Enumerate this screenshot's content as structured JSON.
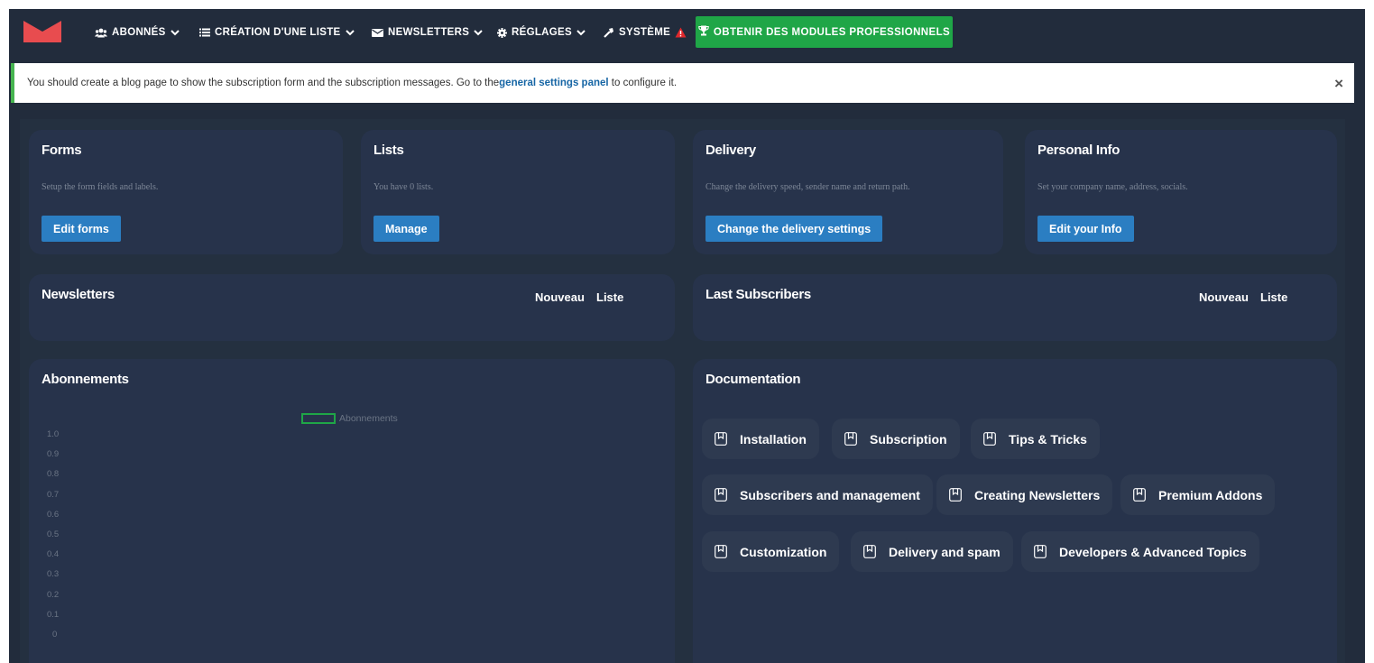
{
  "nav": {
    "items": [
      {
        "label": "ABONNÉS",
        "icon": "users-icon"
      },
      {
        "label": "CRÉATION D'UNE LISTE",
        "icon": "list-icon"
      },
      {
        "label": "NEWSLETTERS",
        "icon": "envelope-icon"
      },
      {
        "label": "RÉGLAGES",
        "icon": "gear-icon"
      },
      {
        "label": "SYSTÈME",
        "icon": "wrench-icon"
      }
    ],
    "pro_button": "OBTENIR DES MODULES PROFESSIONNELS",
    "colors": {
      "background": "#222c3c",
      "logo": "#e84c4f",
      "pro": "#1fa647",
      "warning": "#e0282c"
    }
  },
  "notice": {
    "text_before": "You should create a blog page to show the subscription form and the subscription messages. Go to the ",
    "link": "general settings panel",
    "text_after": " to configure it.",
    "close": "×"
  },
  "cards": [
    {
      "title": "Forms",
      "desc": "Setup the form fields and labels.",
      "button": "Edit forms"
    },
    {
      "title": "Lists",
      "desc": "You have 0 lists.",
      "button": "Manage"
    },
    {
      "title": "Delivery",
      "desc": "Change the delivery speed, sender name and return path.",
      "button": "Change the delivery settings"
    },
    {
      "title": "Personal Info",
      "desc": "Set your company name, address, socials.",
      "button": "Edit your Info"
    }
  ],
  "newsletters": {
    "title": "Newsletters",
    "new": "Nouveau",
    "list": "Liste"
  },
  "subscribers": {
    "title": "Last Subscribers",
    "new": "Nouveau",
    "list": "Liste"
  },
  "abonnements": {
    "title": "Abonnements"
  },
  "chart_data": {
    "type": "line",
    "series": [
      {
        "name": "Abonnements",
        "values": []
      }
    ],
    "yticks": [
      "1.0",
      "0.9",
      "0.8",
      "0.7",
      "0.6",
      "0.5",
      "0.4",
      "0.3",
      "0.2",
      "0.1",
      "0"
    ],
    "ylim": [
      0,
      1
    ],
    "legend": "top"
  },
  "documentation": {
    "title": "Documentation",
    "items": [
      "Installation",
      "Subscription",
      "Tips & Tricks",
      "Subscribers and management",
      "Creating Newsletters",
      "Premium Addons",
      "Customization",
      "Delivery and spam",
      "Developers & Advanced Topics"
    ]
  }
}
